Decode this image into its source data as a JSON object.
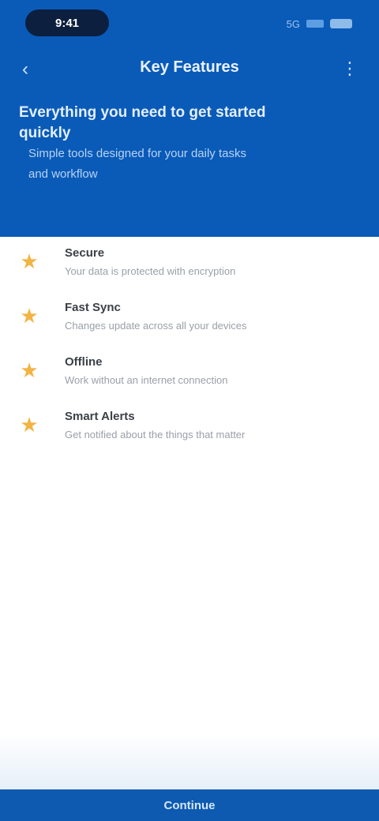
{
  "status_bar": {
    "time": "9:41",
    "network": "5G"
  },
  "nav": {
    "back_icon": "chevron-left-icon",
    "title": "Key Features",
    "menu_icon": "more-vertical-icon"
  },
  "hero": {
    "headline": "Everything you need to get started quickly",
    "subtext": "Simple tools designed for your daily tasks and workflow"
  },
  "features": [
    {
      "icon": "star-icon",
      "title": "Secure",
      "desc": "Your data is protected with encryption"
    },
    {
      "icon": "star-icon",
      "title": "Fast Sync",
      "desc": "Changes update across all your devices"
    },
    {
      "icon": "star-icon",
      "title": "Offline",
      "desc": "Work without an internet connection"
    },
    {
      "icon": "star-icon",
      "title": "Smart Alerts",
      "desc": "Get notified about the things that matter"
    }
  ],
  "bottom_bar": {
    "label": "Continue"
  },
  "colors": {
    "header_blue": "#0a5bb8",
    "accent_orange": "#f2b443",
    "bottom_blue": "#0d5ab0"
  }
}
